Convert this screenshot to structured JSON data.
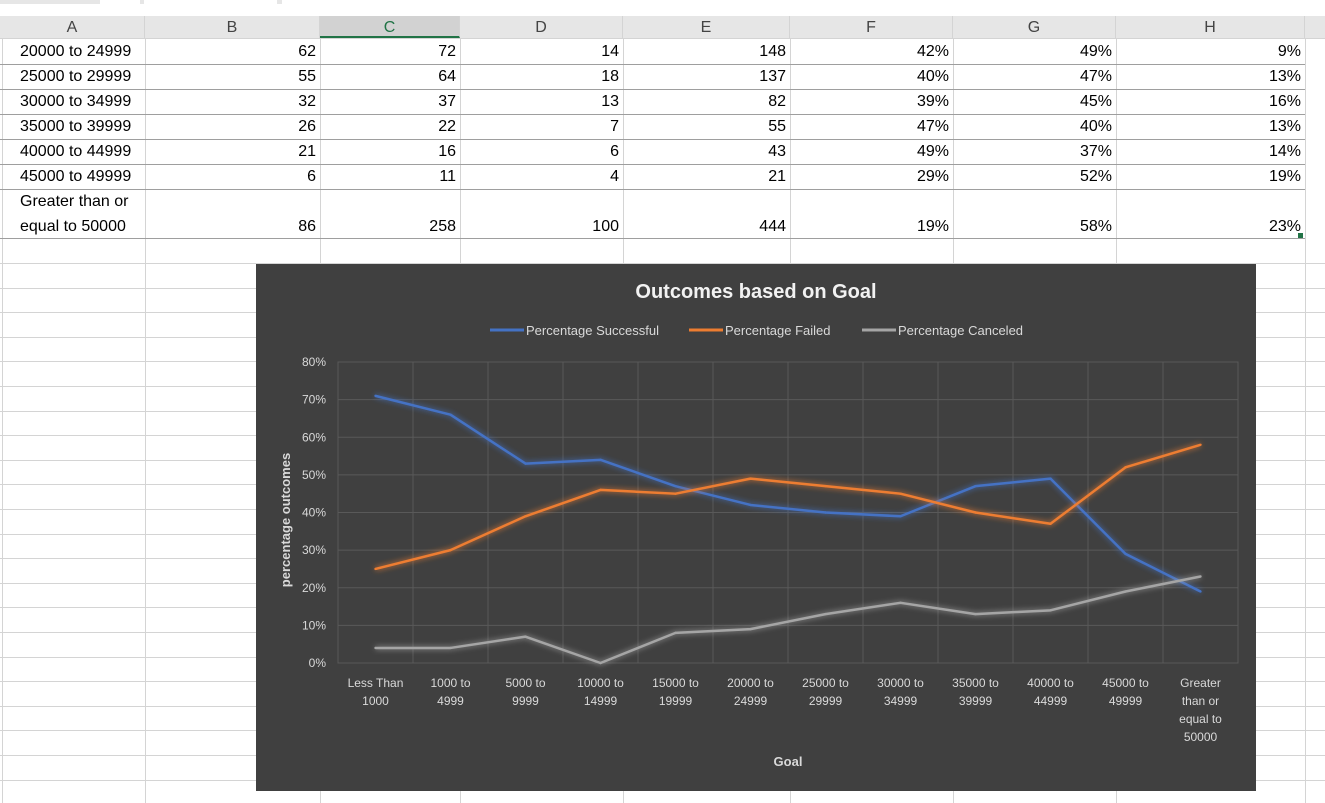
{
  "columns": [
    "A",
    "B",
    "C",
    "D",
    "E",
    "F",
    "G",
    "H"
  ],
  "selected_column": "C",
  "rows": [
    {
      "label": "20000 to 24999",
      "values": [
        "62",
        "72",
        "14",
        "148",
        "42%",
        "49%",
        "9%"
      ]
    },
    {
      "label": "25000 to 29999",
      "values": [
        "55",
        "64",
        "18",
        "137",
        "40%",
        "47%",
        "13%"
      ]
    },
    {
      "label": "30000 to 34999",
      "values": [
        "32",
        "37",
        "13",
        "82",
        "39%",
        "45%",
        "16%"
      ]
    },
    {
      "label": "35000 to 39999",
      "values": [
        "26",
        "22",
        "7",
        "55",
        "47%",
        "40%",
        "13%"
      ]
    },
    {
      "label": "40000 to 44999",
      "values": [
        "21",
        "16",
        "6",
        "43",
        "49%",
        "37%",
        "14%"
      ]
    },
    {
      "label": "45000 to 49999",
      "values": [
        "6",
        "11",
        "4",
        "21",
        "29%",
        "52%",
        "19%"
      ]
    },
    {
      "label_line1": "Greater than or",
      "label_line2": "equal to 50000",
      "values": [
        "86",
        "258",
        "100",
        "444",
        "19%",
        "58%",
        "23%"
      ]
    }
  ],
  "chart_data": {
    "type": "line",
    "title": "Outcomes based on Goal",
    "xlabel": "Goal",
    "ylabel": "percentage outcomes",
    "ylim": [
      0,
      0.8
    ],
    "yticks": [
      "0%",
      "10%",
      "20%",
      "30%",
      "40%",
      "50%",
      "60%",
      "70%",
      "80%"
    ],
    "grid": true,
    "legend_position": "top",
    "categories": [
      [
        "Less Than",
        "1000"
      ],
      [
        "1000 to",
        "4999"
      ],
      [
        "5000 to",
        "9999"
      ],
      [
        "10000 to",
        "14999"
      ],
      [
        "15000 to",
        "19999"
      ],
      [
        "20000 to",
        "24999"
      ],
      [
        "25000 to",
        "29999"
      ],
      [
        "30000 to",
        "34999"
      ],
      [
        "35000 to",
        "39999"
      ],
      [
        "40000 to",
        "44999"
      ],
      [
        "45000 to",
        "49999"
      ],
      [
        "Greater",
        "than or",
        "equal to",
        "50000"
      ]
    ],
    "series": [
      {
        "name": "Percentage Successful",
        "color": "#4472c4",
        "values": [
          0.71,
          0.66,
          0.53,
          0.54,
          0.47,
          0.42,
          0.4,
          0.39,
          0.47,
          0.49,
          0.29,
          0.19
        ]
      },
      {
        "name": "Percentage Failed",
        "color": "#ed7d31",
        "values": [
          0.25,
          0.3,
          0.39,
          0.46,
          0.45,
          0.49,
          0.47,
          0.45,
          0.4,
          0.37,
          0.52,
          0.58
        ]
      },
      {
        "name": "Percentage Canceled",
        "color": "#a5a5a5",
        "values": [
          0.04,
          0.04,
          0.07,
          0.0,
          0.08,
          0.09,
          0.13,
          0.16,
          0.13,
          0.14,
          0.19,
          0.23
        ]
      }
    ]
  }
}
